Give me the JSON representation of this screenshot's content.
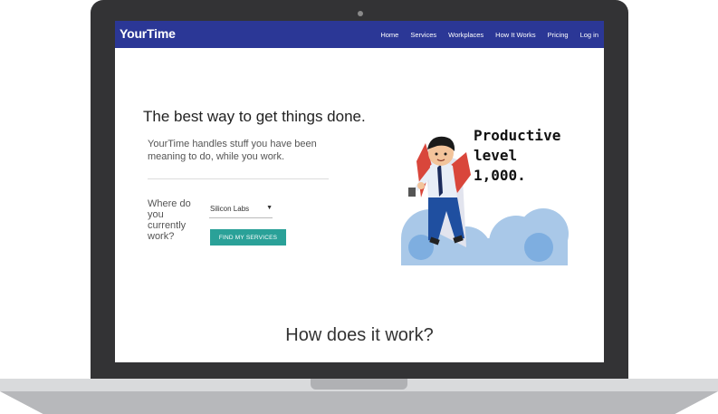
{
  "brand": "YourTime",
  "nav": [
    "Home",
    "Services",
    "Workplaces",
    "How It Works",
    "Pricing",
    "Log in"
  ],
  "hero": {
    "headline": "The best way to get things done.",
    "subhead": "YourTime handles stuff you have been meaning to do, while you work.",
    "where_label": "Where do you currently work?",
    "workplace_selected": "Silicon Labs",
    "cta_label": "FIND MY SERVICES"
  },
  "illustration": {
    "caption_lines": [
      "Productive",
      "level",
      "1,000."
    ]
  },
  "section_title": "How does it work?",
  "colors": {
    "navbar": "#2b3796",
    "cta": "#2aa198",
    "laptop_bezel": "#333335"
  }
}
